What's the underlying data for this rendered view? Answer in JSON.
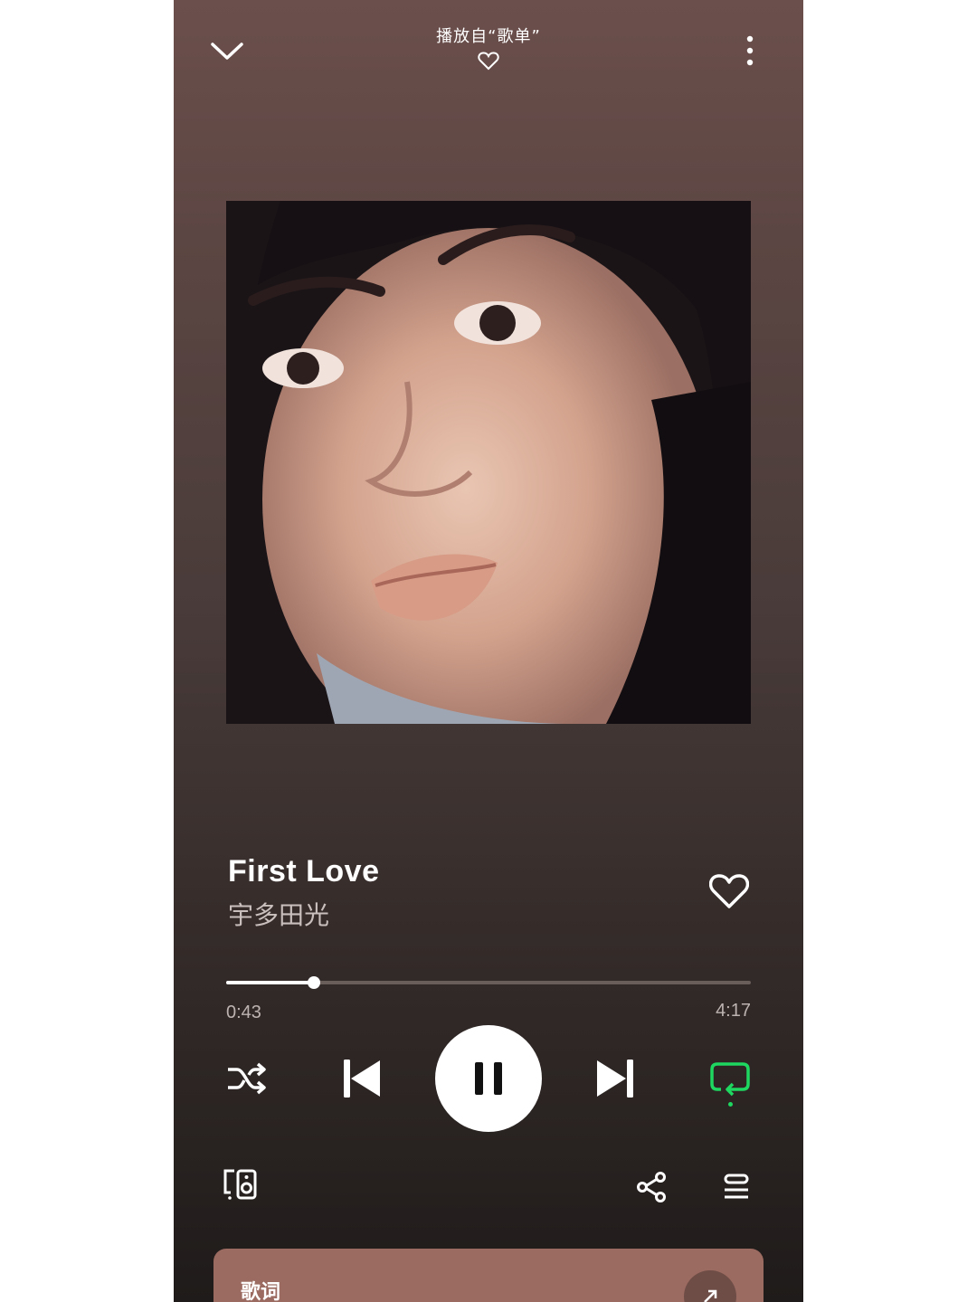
{
  "header": {
    "context_label": "播放自“歌单”",
    "icons": {
      "collapse": "chevron-down-icon",
      "like": "heart-outline-icon",
      "more": "more-vertical-icon"
    }
  },
  "track": {
    "title": "First Love",
    "artist": "宇多田光"
  },
  "playback": {
    "elapsed": "0:43",
    "duration": "4:17",
    "progress_fraction": 0.167,
    "state": "playing",
    "repeat_active": true
  },
  "controls": {
    "icons": [
      "shuffle-icon",
      "previous-icon",
      "pause-icon",
      "next-icon",
      "repeat-icon"
    ]
  },
  "footer": {
    "icons": [
      "devices-icon",
      "share-icon",
      "queue-icon"
    ]
  },
  "lyrics": {
    "label": "歌词"
  },
  "colors": {
    "background_top": "#6b4f4c",
    "background_bottom": "#1f1b1a",
    "accent_green": "#1ed760",
    "lyrics_card": "#9b6a60"
  }
}
